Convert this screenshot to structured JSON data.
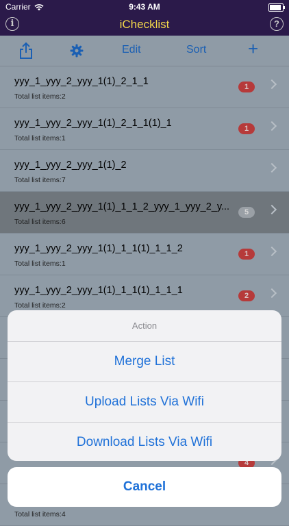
{
  "status": {
    "carrier": "Carrier",
    "time": "9:43 AM"
  },
  "titlebar": {
    "title": "iChecklist",
    "info_icon": "info-icon",
    "help_icon": "help-icon"
  },
  "toolbar": {
    "edit_label": "Edit",
    "sort_label": "Sort",
    "add_label": "+",
    "share_icon": "share-icon",
    "settings_icon": "gear-icon"
  },
  "colors": {
    "header_bg": "#2b1a4a",
    "title": "#f4d84a",
    "accent": "#1f71d8",
    "badge": "#b63a3a"
  },
  "lists": [
    {
      "name": "yyy_1_yyy_2_yyy_1(1)_2_1_1",
      "subtitle": "Total list items:2",
      "badge": "1"
    },
    {
      "name": "yyy_1_yyy_2_yyy_1(1)_2_1_1(1)_1",
      "subtitle": "Total list items:1",
      "badge": "1"
    },
    {
      "name": "yyy_1_yyy_2_yyy_1(1)_2",
      "subtitle": "Total list items:7",
      "badge": ""
    },
    {
      "name": "yyy_1_yyy_2_yyy_1(1)_1_1_2_yyy_1_yyy_2_y...",
      "subtitle": "Total list items:6",
      "badge": "5"
    },
    {
      "name": "yyy_1_yyy_2_yyy_1(1)_1_1(1)_1_1_2",
      "subtitle": "Total list items:1",
      "badge": "1"
    },
    {
      "name": "yyy_1_yyy_2_yyy_1(1)_1_1(1)_1_1_1",
      "subtitle": "Total list items:2",
      "badge": "2"
    },
    {
      "name": "",
      "subtitle": "",
      "badge": ""
    },
    {
      "name": "",
      "subtitle": "",
      "badge": ""
    },
    {
      "name": "",
      "subtitle": "",
      "badge": ""
    },
    {
      "name": "",
      "subtitle": "",
      "badge": "4"
    },
    {
      "name": "",
      "subtitle": "Total list items:4",
      "badge": ""
    }
  ],
  "action_sheet": {
    "title": "Action",
    "options": [
      "Merge List",
      "Upload Lists Via Wifi",
      "Download Lists Via Wifi"
    ],
    "cancel_label": "Cancel"
  }
}
